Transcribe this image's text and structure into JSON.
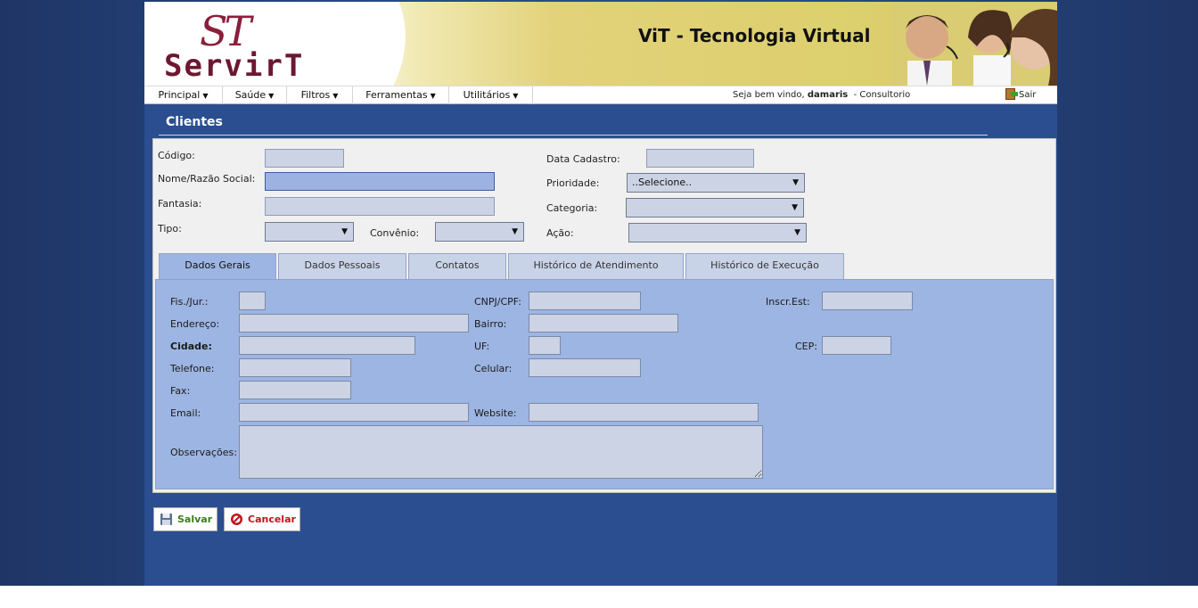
{
  "header": {
    "logo_monogram": "ST",
    "logo_name": "ServirT",
    "brand_title": "ViT - Tecnologia Virtual"
  },
  "menu": {
    "items": [
      {
        "label": "Principal"
      },
      {
        "label": "Saúde"
      },
      {
        "label": "Filtros"
      },
      {
        "label": "Ferramentas"
      },
      {
        "label": "Utilitários"
      }
    ],
    "welcome_prefix": "Seja bem vindo,",
    "user": "damaris",
    "welcome_suffix": "- Consultorio",
    "logout_label": "Sair"
  },
  "page_title": "Clientes",
  "form": {
    "codigo_label": "Código:",
    "codigo_value": "",
    "nome_label": "Nome/Razão Social:",
    "nome_value": "",
    "fantasia_label": "Fantasia:",
    "fantasia_value": "",
    "tipo_label": "Tipo:",
    "tipo_value": "",
    "convenio_label": "Convênio:",
    "convenio_value": "",
    "data_cadastro_label": "Data Cadastro:",
    "data_cadastro_value": "",
    "prioridade_label": "Prioridade:",
    "prioridade_value": "..Selecione..",
    "categoria_label": "Categoria:",
    "categoria_value": "",
    "acao_label": "Ação:",
    "acao_value": ""
  },
  "tabs": [
    {
      "label": "Dados Gerais",
      "active": true
    },
    {
      "label": "Dados Pessoais",
      "active": false
    },
    {
      "label": "Contatos",
      "active": false
    },
    {
      "label": "Histórico de Atendimento",
      "active": false
    },
    {
      "label": "Histórico de Execução",
      "active": false
    }
  ],
  "dados_gerais": {
    "fis_jur_label": "Fis./Jur.:",
    "cnpj_label": "CNPJ/CPF:",
    "inscr_est_label": "Inscr.Est:",
    "endereco_label": "Endereço:",
    "bairro_label": "Bairro:",
    "cidade_label": "Cidade:",
    "uf_label": "UF:",
    "cep_label": "CEP:",
    "telefone_label": "Telefone:",
    "celular_label": "Celular:",
    "fax_label": "Fax:",
    "email_label": "Email:",
    "website_label": "Website:",
    "observacoes_label": "Observações:"
  },
  "actions": {
    "save_label": "Salvar",
    "cancel_label": "Cancelar",
    "save_color": "#3c7d1c",
    "cancel_color": "#c0141a"
  }
}
